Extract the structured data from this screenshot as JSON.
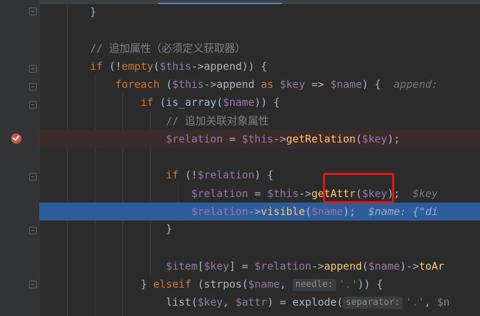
{
  "editor": {
    "lines": [
      {
        "seg": [
          "}"
        ]
      },
      {
        "seg": [
          "// 追加属性（必须定义获取器）"
        ]
      },
      {
        "seg": [
          "if",
          " (!",
          "empty",
          "(",
          "$this",
          "->append)) {"
        ]
      },
      {
        "seg": [
          "foreach",
          " (",
          "$this",
          "->append ",
          "as",
          " ",
          "$key",
          " => ",
          "$name",
          ") {",
          "append: "
        ]
      },
      {
        "seg": [
          "if",
          " (is_array(",
          "$name",
          ")) {"
        ]
      },
      {
        "seg": [
          "// 追加关联对象属性"
        ]
      },
      {
        "seg": [
          "$relation",
          " = ",
          "$this",
          "->",
          "getRelation",
          "(",
          "$key",
          ");"
        ]
      },
      {
        "seg": [
          "if",
          " (!",
          "$relation",
          ") {"
        ]
      },
      {
        "seg": [
          "$relation",
          " = ",
          "$this",
          "->",
          "getAttr",
          "(",
          "$key",
          ");",
          "$key"
        ]
      },
      {
        "seg": [
          "$relation",
          "->",
          "visible",
          "(",
          "$name",
          ");",
          "$name: {\"di"
        ]
      },
      {
        "seg": [
          "}"
        ]
      },
      {
        "seg": [
          "$item",
          "[",
          "$key",
          "] = ",
          "$relation",
          "->",
          "append",
          "(",
          "$name",
          ")->",
          "toAr"
        ]
      },
      {
        "seg": [
          "} ",
          "elseif",
          " (strpos(",
          "$name",
          ", ",
          "needle:",
          "'.'",
          ")) {"
        ]
      },
      {
        "seg": [
          "list(",
          "$key",
          ", ",
          "$attr",
          ") = explode(",
          "separator:",
          "'.'",
          ", ",
          "$n"
        ]
      }
    ]
  },
  "colors": {
    "keyword": "#cc7832",
    "variable": "#9876aa",
    "function": "#ffc66d",
    "string": "#6a8759",
    "comment": "#808080",
    "execution_line": "#2d5d9c",
    "breakpoint_line": "#3b2a2a",
    "breakpoint": "#c75450",
    "highlight_box": "#e8170f"
  },
  "icons": {
    "breakpoint": "breakpoint-check-icon",
    "fold": "fold-marker-icon"
  }
}
